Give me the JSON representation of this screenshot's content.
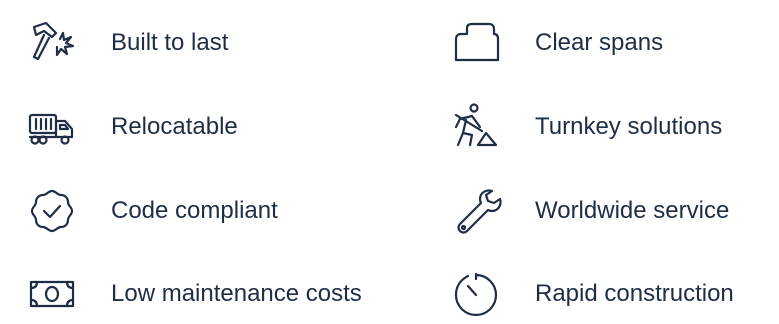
{
  "features": [
    {
      "label": "Built to last",
      "icon": "hammer-icon"
    },
    {
      "label": "Relocatable",
      "icon": "truck-icon"
    },
    {
      "label": "Code compliant",
      "icon": "badge-check-icon"
    },
    {
      "label": "Low maintenance costs",
      "icon": "money-bill-icon"
    },
    {
      "label": "Clear spans",
      "icon": "clear-span-icon"
    },
    {
      "label": "Turnkey solutions",
      "icon": "worker-shovel-icon"
    },
    {
      "label": "Worldwide service",
      "icon": "wrench-icon"
    },
    {
      "label": "Rapid construction",
      "icon": "timer-icon"
    }
  ],
  "colors": {
    "text": "#1f2d45",
    "icon_stroke": "#1f2d45",
    "background": "#ffffff"
  }
}
